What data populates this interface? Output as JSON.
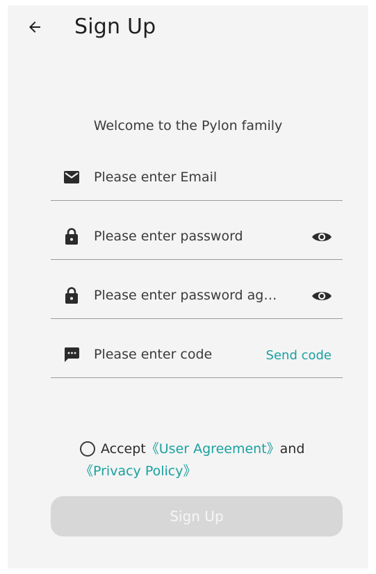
{
  "header": {
    "title": "Sign Up",
    "back_icon": "arrow-left-icon"
  },
  "welcome": "Welcome to the Pylon family",
  "form": {
    "email": {
      "placeholder": "Please enter Email",
      "icon": "mail-icon"
    },
    "password": {
      "placeholder": "Please enter password",
      "icon": "lock-icon",
      "toggle_icon": "eye-icon"
    },
    "password_confirm": {
      "placeholder": "Please enter password ag…",
      "icon": "lock-icon",
      "toggle_icon": "eye-icon"
    },
    "code": {
      "placeholder": "Please enter code",
      "icon": "message-icon",
      "send_label": "Send code"
    }
  },
  "agreement": {
    "accept": "Accept",
    "user_agreement": "《User Agreement》",
    "and": "and",
    "privacy_policy": "《Privacy Policy》",
    "checked": false
  },
  "submit_label": "Sign Up",
  "colors": {
    "accent": "#1aa0a0",
    "background": "#f4f4f4",
    "button_disabled": "#d7d7d7"
  }
}
